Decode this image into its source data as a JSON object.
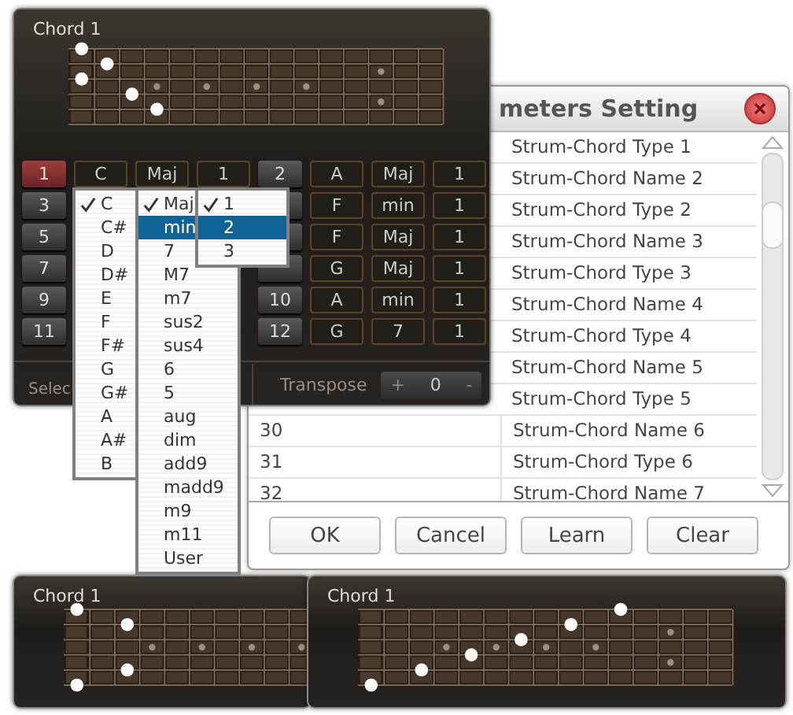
{
  "dialog": {
    "title": "meters Setting",
    "rows": [
      {
        "col2": "Strum-Chord Type 1"
      },
      {
        "col2": "Strum-Chord Name 2"
      },
      {
        "col2": "Strum-Chord Type 2"
      },
      {
        "col2": "Strum-Chord Name 3"
      },
      {
        "col2": "Strum-Chord Type 3"
      },
      {
        "col2": "Strum-Chord Name 4"
      },
      {
        "col2": "Strum-Chord Type 4"
      },
      {
        "col2": "Strum-Chord Name 5"
      },
      {
        "col2": "Strum-Chord Type 5"
      },
      {
        "col1": "30",
        "col2": "Strum-Chord Name 6"
      },
      {
        "col1": "31",
        "col2": "Strum-Chord Type 6"
      },
      {
        "col1": "32",
        "col2": "Strum-Chord Name 7"
      }
    ],
    "buttons": [
      "OK",
      "Cancel",
      "Learn",
      "Clear"
    ]
  },
  "main_panel": {
    "title": "Chord 1",
    "chords": [
      {
        "number": "1",
        "selected": true,
        "root": "C",
        "type": "Maj",
        "count": "1"
      },
      {
        "number": "2",
        "selected": false,
        "root": "A",
        "type": "Maj",
        "count": "1"
      },
      {
        "number": "3",
        "selected": false
      },
      {
        "selected": false,
        "root": "F",
        "type": "min",
        "count": "1"
      },
      {
        "number": "5",
        "selected": false
      },
      {
        "selected": false,
        "root": "F",
        "type": "Maj",
        "count": "1"
      },
      {
        "number": "7",
        "selected": false
      },
      {
        "selected": false,
        "root": "G",
        "type": "Maj",
        "count": "1"
      },
      {
        "number": "9",
        "selected": false
      },
      {
        "number": "10",
        "selected": false,
        "root": "A",
        "type": "min",
        "count": "1"
      },
      {
        "number": "11",
        "selected": false
      },
      {
        "number": "12",
        "selected": false,
        "root": "G",
        "type": "7",
        "count": "1"
      }
    ],
    "select_label": "Selec",
    "transpose": {
      "label": "Transpose",
      "plus": "+",
      "value": "0",
      "minus": "-"
    }
  },
  "bottom_panels": [
    {
      "title": "Chord 1"
    },
    {
      "title": "Chord 1"
    }
  ],
  "menus": [
    {
      "kind": "root",
      "items": [
        {
          "label": "C",
          "checked": true,
          "selected": false
        },
        {
          "label": "C#",
          "checked": false,
          "selected": false
        },
        {
          "label": "D",
          "checked": false,
          "selected": false
        },
        {
          "label": "D#",
          "checked": false,
          "selected": false
        },
        {
          "label": "E",
          "checked": false,
          "selected": false
        },
        {
          "label": "F",
          "checked": false,
          "selected": false
        },
        {
          "label": "F#",
          "checked": false,
          "selected": false
        },
        {
          "label": "G",
          "checked": false,
          "selected": false
        },
        {
          "label": "G#",
          "checked": false,
          "selected": false
        },
        {
          "label": "A",
          "checked": false,
          "selected": false
        },
        {
          "label": "A#",
          "checked": false,
          "selected": false
        },
        {
          "label": "B",
          "checked": false,
          "selected": false
        }
      ]
    },
    {
      "kind": "type",
      "items": [
        {
          "label": "Maj",
          "checked": true,
          "selected": false
        },
        {
          "label": "min",
          "checked": false,
          "selected": true
        },
        {
          "label": "7",
          "checked": false,
          "selected": false
        },
        {
          "label": "M7",
          "checked": false,
          "selected": false
        },
        {
          "label": "m7",
          "checked": false,
          "selected": false
        },
        {
          "label": "sus2",
          "checked": false,
          "selected": false
        },
        {
          "label": "sus4",
          "checked": false,
          "selected": false
        },
        {
          "label": "6",
          "checked": false,
          "selected": false
        },
        {
          "label": "5",
          "checked": false,
          "selected": false
        },
        {
          "label": "aug",
          "checked": false,
          "selected": false
        },
        {
          "label": "dim",
          "checked": false,
          "selected": false
        },
        {
          "label": "add9",
          "checked": false,
          "selected": false
        },
        {
          "label": "madd9",
          "checked": false,
          "selected": false
        },
        {
          "label": "m9",
          "checked": false,
          "selected": false
        },
        {
          "label": "m11",
          "checked": false,
          "selected": false
        },
        {
          "label": "User",
          "checked": false,
          "selected": false
        }
      ]
    },
    {
      "kind": "count",
      "items": [
        {
          "label": "1",
          "checked": true,
          "selected": false
        },
        {
          "label": "2",
          "checked": false,
          "selected": true
        },
        {
          "label": "3",
          "checked": false,
          "selected": false
        }
      ]
    }
  ]
}
